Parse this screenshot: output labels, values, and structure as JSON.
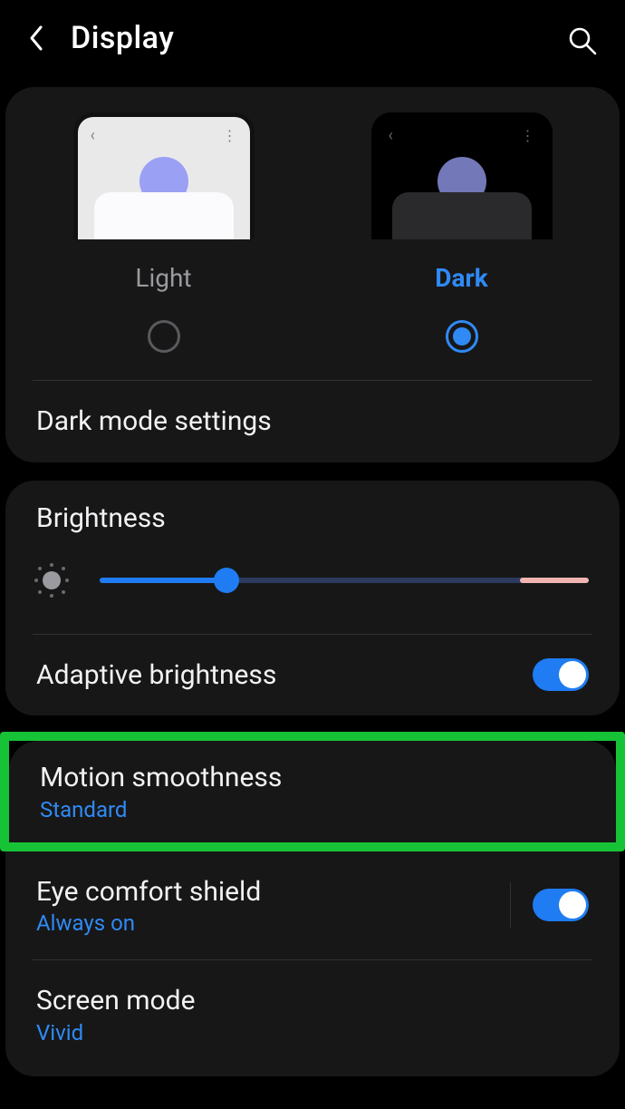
{
  "header": {
    "title": "Display"
  },
  "theme": {
    "light_label": "Light",
    "dark_label": "Dark",
    "selected": "dark"
  },
  "dark_mode_settings_label": "Dark mode settings",
  "brightness": {
    "title": "Brightness",
    "value_pct": 26,
    "max_zone_pct": 14
  },
  "adaptive_brightness": {
    "title": "Adaptive brightness",
    "enabled": true
  },
  "motion_smoothness": {
    "title": "Motion smoothness",
    "value": "Standard"
  },
  "eye_comfort": {
    "title": "Eye comfort shield",
    "value": "Always on",
    "enabled": true
  },
  "screen_mode": {
    "title": "Screen mode",
    "value": "Vivid"
  },
  "colors": {
    "accent": "#2f8af5",
    "highlight": "#17c336"
  }
}
